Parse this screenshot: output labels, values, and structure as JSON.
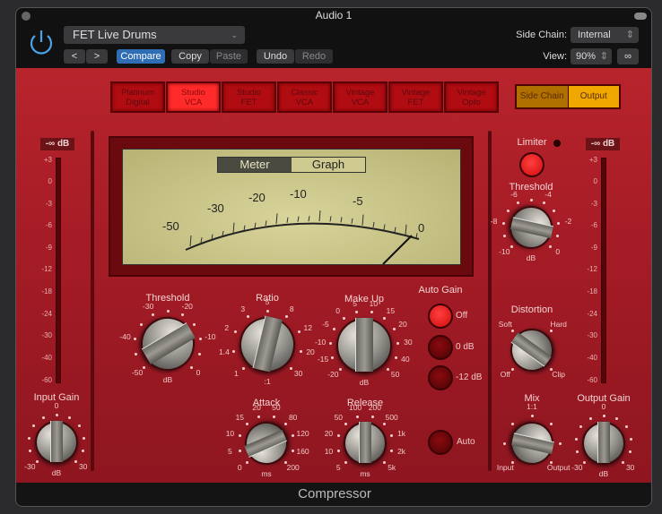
{
  "window": {
    "title": "Audio 1",
    "footer": "Compressor"
  },
  "header": {
    "preset": "FET Live Drums",
    "prev": "<",
    "next": ">",
    "compare": "Compare",
    "copy": "Copy",
    "paste": "Paste",
    "undo": "Undo",
    "redo": "Redo",
    "side_chain_label": "Side Chain:",
    "side_chain_value": "Internal",
    "view_label": "View:",
    "view_value": "90%"
  },
  "models": [
    {
      "label": "Platinum Digital",
      "active": false
    },
    {
      "label": "Studio VCA",
      "active": true
    },
    {
      "label": "Studio FET",
      "active": false
    },
    {
      "label": "Classic VCA",
      "active": false
    },
    {
      "label": "Vintage VCA",
      "active": false
    },
    {
      "label": "Vintage FET",
      "active": false
    },
    {
      "label": "Vintage Opto",
      "active": false
    }
  ],
  "view_toggle": {
    "side_chain": "Side Chain",
    "output": "Output"
  },
  "meters": {
    "input_readout": "-∞ dB",
    "output_readout": "-∞ dB",
    "scale": [
      "+3",
      "0",
      "-3",
      "-6",
      "-9",
      "-12",
      "-18",
      "-24",
      "-30",
      "-40",
      "-60"
    ]
  },
  "vu": {
    "tabs": [
      "Meter",
      "Graph"
    ],
    "active_tab": "Meter",
    "scale": [
      "-50",
      "-30",
      "-20",
      "-10",
      "-5",
      "0"
    ]
  },
  "knobs": {
    "threshold": {
      "title": "Threshold",
      "unit": "dB",
      "ticks": [
        "-50",
        "",
        "-40",
        "",
        "-30",
        "",
        "-20",
        "",
        "-10",
        "",
        "0"
      ],
      "value": 0.72
    },
    "ratio": {
      "title": "Ratio",
      "unit": ":1",
      "ticks": [
        "1",
        "1.4",
        "2",
        "3",
        "5",
        "8",
        "12",
        "20",
        "30"
      ],
      "value": 0.55
    },
    "makeup": {
      "title": "Make Up",
      "unit": "dB",
      "ticks": [
        "-20",
        "-15",
        "-10",
        "-5",
        "0",
        "5",
        "10",
        "15",
        "20",
        "30",
        "40",
        "50"
      ],
      "value": 0.5
    },
    "attack": {
      "title": "Attack",
      "unit": "ms",
      "ticks": [
        "0",
        "5",
        "10",
        "15",
        "20",
        "50",
        "80",
        "120",
        "160",
        "200"
      ],
      "value": 0.08
    },
    "release": {
      "title": "Release",
      "unit": "ms",
      "ticks": [
        "5",
        "10",
        "20",
        "50",
        "100",
        "200",
        "500",
        "1k",
        "2k",
        "5k"
      ],
      "value": 0.5
    },
    "input_gain": {
      "title": "Input Gain",
      "unit": "dB",
      "ticks": [
        "-30",
        "",
        "",
        "",
        "",
        "0",
        "",
        "",
        "",
        "",
        "30"
      ],
      "value": 0.5
    },
    "limiter_threshold": {
      "title": "Threshold",
      "unit": "dB",
      "ticks": [
        "-10",
        "",
        "-8",
        "",
        "-6",
        "",
        "-4",
        "",
        "-2",
        "",
        "0"
      ],
      "value": 0.88
    },
    "distortion": {
      "title": "Distortion",
      "unit": "",
      "ticks": [
        "Off",
        "Soft",
        "Hard",
        "Clip"
      ],
      "value": 0.3
    },
    "mix": {
      "title": "Mix",
      "unit": "",
      "ticks": [
        "Input",
        "",
        "",
        "1:1",
        "",
        "",
        "Output"
      ],
      "value": 0.88
    },
    "output_gain": {
      "title": "Output Gain",
      "unit": "dB",
      "ticks": [
        "-30",
        "",
        "",
        "",
        "",
        "0",
        "",
        "",
        "",
        "",
        "30"
      ],
      "value": 0.5
    }
  },
  "auto_gain": {
    "title": "Auto Gain",
    "options": [
      "Off",
      "0 dB",
      "-12 dB"
    ],
    "selected": "Off",
    "auto_label": "Auto",
    "auto_on": false
  },
  "limiter": {
    "label": "Limiter",
    "on": true
  },
  "colors": {
    "panel": "#a61c26",
    "accent": "#2f6db5",
    "output_active": "#f0a800"
  }
}
